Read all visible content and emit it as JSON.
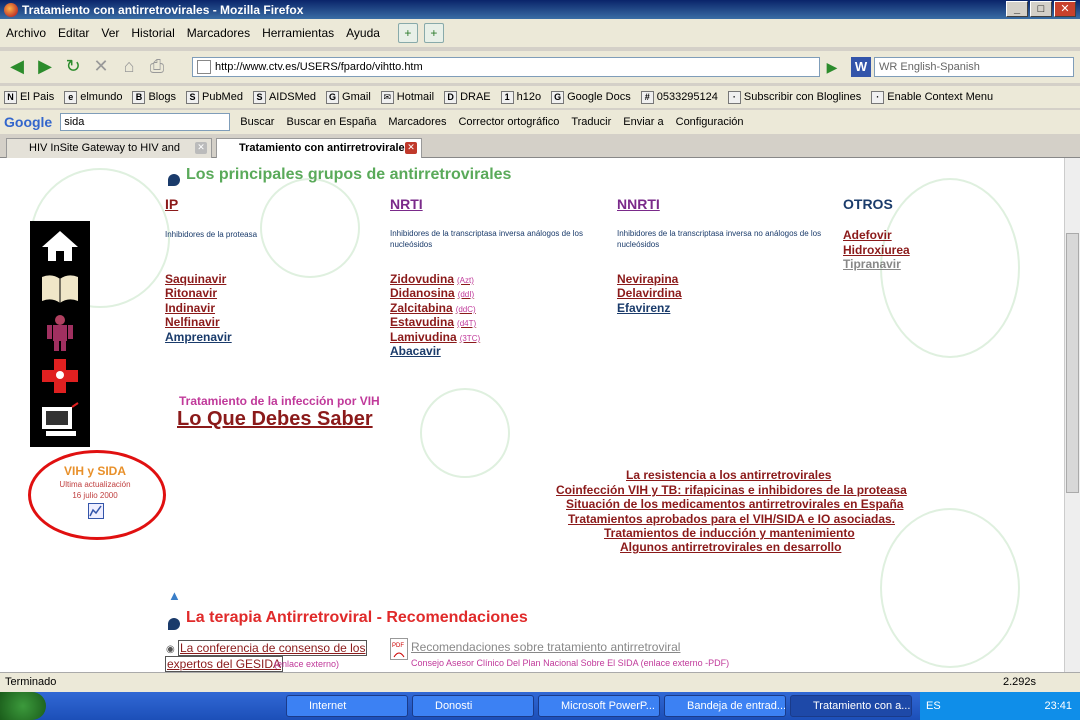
{
  "window": {
    "title": "Tratamiento con antirretrovirales - Mozilla Firefox"
  },
  "menu": [
    "Archivo",
    "Editar",
    "Ver",
    "Historial",
    "Marcadores",
    "Herramientas",
    "Ayuda"
  ],
  "nav": {
    "url": "http://www.ctv.es/USERS/fpardo/vihtto.htm",
    "search_placeholder": "WR English-Spanish"
  },
  "bookmarks": [
    "El Pais",
    "elmundo",
    "Blogs",
    "PubMed",
    "AIDSMed",
    "Gmail",
    "Hotmail",
    "DRAE",
    "h12o",
    "Google Docs",
    "0533295124",
    "Subscribir con Bloglines",
    "Enable Context Menu"
  ],
  "google_toolbar": {
    "logo": "Google",
    "query": "sida",
    "items": [
      "Buscar",
      "Buscar en España",
      "Marcadores",
      "Corrector ortográfico",
      "Traducir",
      "Enviar a",
      "Configuración"
    ]
  },
  "tabs": [
    {
      "label": "HIV InSite Gateway to HIV and AIDS...",
      "active": false
    },
    {
      "label": "Tratamiento con antirretrovirales",
      "active": true
    }
  ],
  "page": {
    "section1_title": "Los principales grupos de antirretrovirales",
    "columns": [
      {
        "title": "IP",
        "desc": "Inhibidores de la proteasa",
        "drugs": [
          {
            "name": "Saquinavir",
            "abbr": ""
          },
          {
            "name": "Ritonavir",
            "abbr": ""
          },
          {
            "name": "Indinavir",
            "abbr": ""
          },
          {
            "name": "Nelfinavir",
            "abbr": ""
          },
          {
            "name": "Amprenavir",
            "abbr": ""
          }
        ]
      },
      {
        "title": "NRTI",
        "desc": "Inhibidores de la transcriptasa inversa análogos de los nucleósidos",
        "drugs": [
          {
            "name": "Zidovudina",
            "abbr": "(Azt)"
          },
          {
            "name": "Didanosina",
            "abbr": "(ddI)"
          },
          {
            "name": "Zalcitabina",
            "abbr": "(ddC)"
          },
          {
            "name": "Estavudina",
            "abbr": "(d4T)"
          },
          {
            "name": "Lamivudina",
            "abbr": "(3TC)"
          },
          {
            "name": "Abacavir",
            "abbr": ""
          }
        ]
      },
      {
        "title": "NNRTI",
        "desc": "Inhibidores de la transcriptasa inversa no análogos de los nucleósidos",
        "drugs": [
          {
            "name": "Nevirapina",
            "abbr": ""
          },
          {
            "name": "Delavirdina",
            "abbr": ""
          },
          {
            "name": "Efavirenz",
            "abbr": ""
          }
        ]
      },
      {
        "title": "OTROS",
        "desc": "",
        "drugs": [
          {
            "name": "Adefovir",
            "abbr": ""
          },
          {
            "name": "Hidroxiurea",
            "abbr": ""
          },
          {
            "name": "Tipranavir",
            "abbr": ""
          }
        ]
      }
    ],
    "feature": {
      "subtitle": "Tratamiento de la infección por VIH",
      "title": "Lo Que Debes Saber"
    },
    "badge": {
      "title": "VIH y SIDA",
      "line1": "Ultima actualización",
      "line2": "16 julio 2000"
    },
    "links": [
      "La resistencia a los antirretrovirales",
      "Coinfección VIH y TB: rifapicinas e inhibidores de la proteasa",
      "Situación de los medicamentos antirretrovirales en España",
      "Tratamientos aprobados para el VIH/SIDA e IO asociadas.",
      "Tratamientos de inducción y mantenimiento",
      "Algunos antirretrovirales en desarrollo"
    ],
    "section2_title": "La terapia Antirretroviral - Recomendaciones",
    "rec1_line1": "La conferencia de consenso de los",
    "rec1_line2": "expertos del GESIDA",
    "rec1_note": "(enlace externo)",
    "rec2_title": "Recomendaciones sobre tratamiento antirretroviral",
    "rec2_note": "Consejo Asesor Clínico Del Plan Nacional Sobre El SIDA (enlace externo -PDF)"
  },
  "status": {
    "text": "Terminado",
    "time": "2.292s"
  },
  "taskbar": {
    "tasks": [
      "Internet",
      "Donosti",
      "Microsoft PowerP...",
      "Bandeja de entrad...",
      "Tratamiento con a..."
    ],
    "lang": "ES",
    "clock": "23:41"
  }
}
